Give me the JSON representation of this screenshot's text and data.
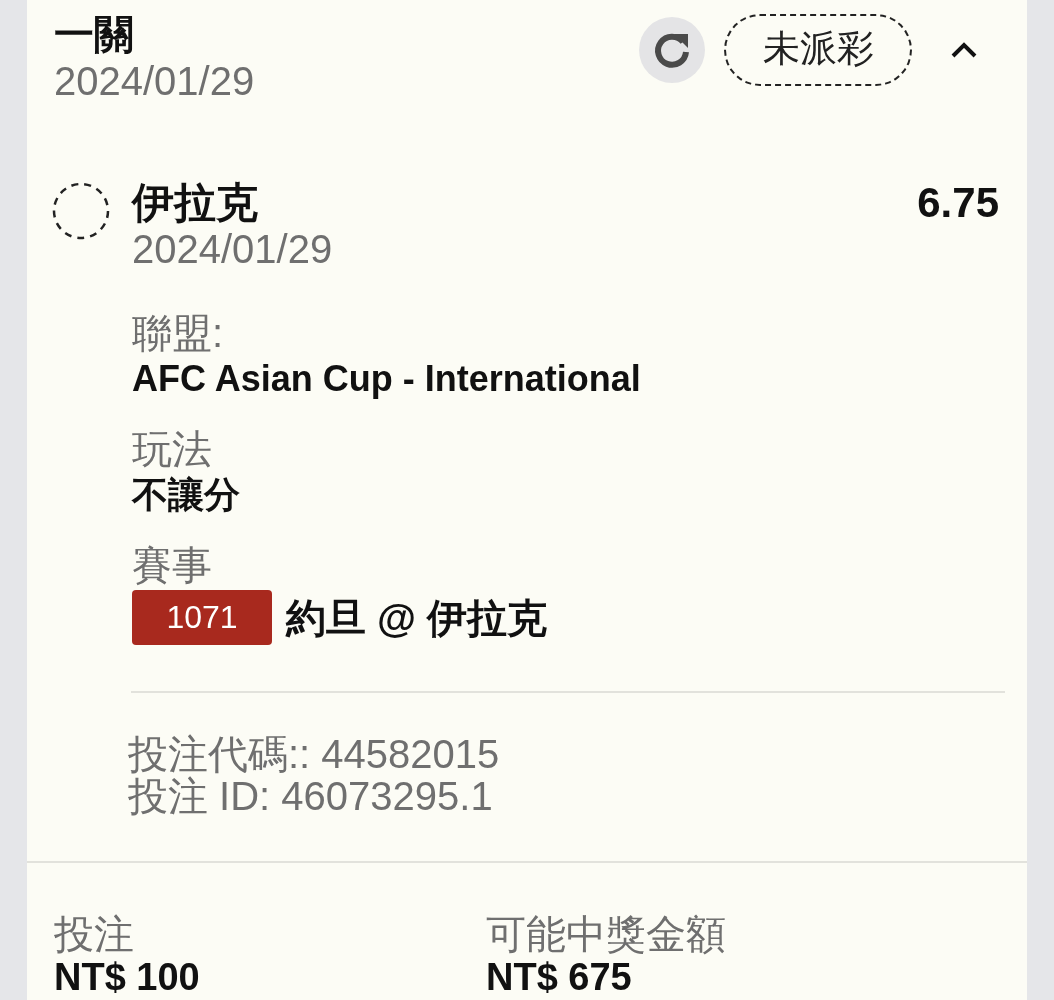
{
  "bet": {
    "type": "一關",
    "date": "2024/01/29",
    "status": "未派彩",
    "expanded": true
  },
  "selections": [
    {
      "kind": "pending",
      "team": "伊拉克",
      "date": "2024/01/29",
      "odds": "6.75",
      "details": [
        {
          "kind": "text",
          "label": "聯盟:",
          "value": "AFC Asian Cup - International"
        },
        {
          "kind": "text",
          "label": "玩法",
          "value": "不讓分"
        },
        {
          "kind": "match",
          "label": "賽事",
          "match_no": "1071",
          "value": "約旦 @ 伊拉克"
        }
      ]
    }
  ],
  "references": [
    "投注代碼:: 44582015",
    "投注 ID: 46073295.1"
  ],
  "summary": [
    {
      "label": "投注",
      "value": "NT$ 100"
    },
    {
      "label": "可能中獎金額",
      "value": "NT$ 675"
    }
  ]
}
